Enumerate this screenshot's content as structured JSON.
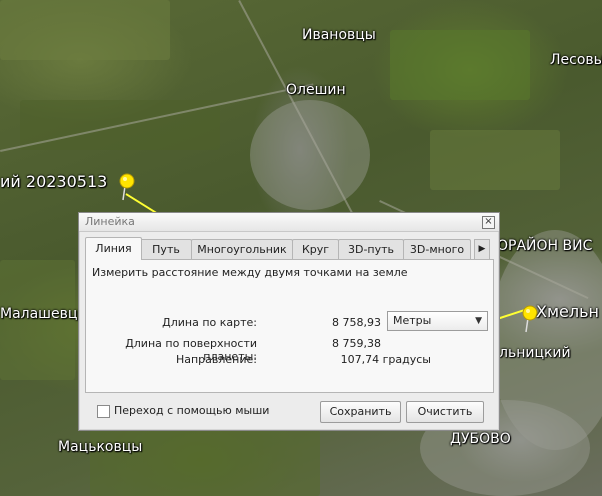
{
  "map": {
    "labels": {
      "ivankovtsy": "Ивановцы",
      "oleshin": "Олешин",
      "lesovoe": "Лесовы",
      "placemark": "ий 20230513",
      "raion": "ОРАЙОН ВИС",
      "khmelnitsky_big": "Хмельн",
      "khmelnitsky_small": "льницкий",
      "malashevtsy": "Малашевцы",
      "matskovtsy": "Мацьковцы",
      "dubovo": "ДУБОВО"
    },
    "line_color": "#ffff33",
    "pin_color": "#ffe400"
  },
  "dialog": {
    "title": "Линейка",
    "close_symbol": "×",
    "tabs": [
      {
        "label": "Линия",
        "active": true
      },
      {
        "label": "Путь",
        "active": false
      },
      {
        "label": "Многоугольник",
        "active": false
      },
      {
        "label": "Круг",
        "active": false
      },
      {
        "label": "3D-путь",
        "active": false
      },
      {
        "label": "3D-много",
        "active": false
      }
    ],
    "tab_scroll_symbol": "▶",
    "description": "Измерить расстояние между двумя точками на земле",
    "map_length": {
      "label": "Длина по карте:",
      "value": "8 758,93"
    },
    "unit": {
      "selected": "Метры",
      "arrow": "▼"
    },
    "ground_length": {
      "label": "Длина по поверхности планеты:",
      "value": "8 759,38"
    },
    "heading": {
      "label": "Направление:",
      "value": "107,74 градусы"
    },
    "mouse_nav_label": "Переход с помощью мыши",
    "mouse_nav_checked": false,
    "save_button": "Сохранить",
    "clear_button": "Очистить"
  }
}
